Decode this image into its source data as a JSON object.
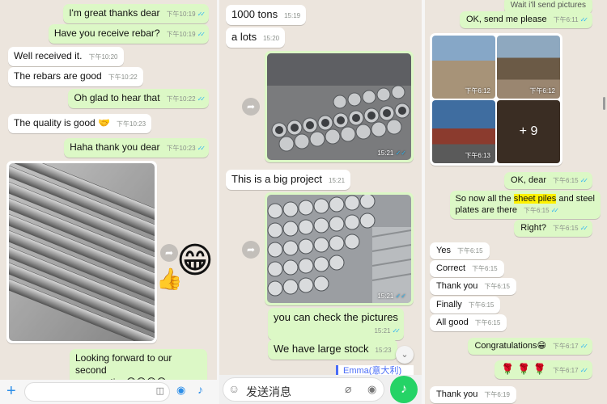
{
  "panel1": {
    "messages": [
      {
        "text": "I'm great thanks dear",
        "time": "下午10:19",
        "dir": "out",
        "read": true
      },
      {
        "text": "Have you receive rebar?",
        "time": "下午10:19",
        "dir": "out",
        "read": true
      },
      {
        "text": "Well received it.",
        "time": "下午10:20",
        "dir": "in"
      },
      {
        "text": "The rebars are good",
        "time": "下午10:22",
        "dir": "in"
      },
      {
        "text": "Oh glad to hear that",
        "time": "下午10:22",
        "dir": "out",
        "read": true
      },
      {
        "text": "The quality is good",
        "emoji": "🤝",
        "time": "下午10:23",
        "dir": "in"
      },
      {
        "text": "Haha thank you dear",
        "time": "下午10:23",
        "dir": "out",
        "read": true
      }
    ],
    "forward_line1": "Looking forward to our second",
    "forward_line2": "cooperation",
    "forward_emojis": "😁😁😁😁",
    "sticker_face": "😁",
    "sticker_thumbs": "👍"
  },
  "panel2": {
    "messages": [
      {
        "text": "1000 tons",
        "time": "15:19"
      },
      {
        "text": "a lots",
        "time": "15:20"
      }
    ],
    "image1_time": "15:21",
    "big_project": {
      "text": "This is a big project",
      "time": "15:21"
    },
    "image2_time": "15:21",
    "check_pictures": {
      "text": "you can check the pictures",
      "time": "15:21"
    },
    "large_stock": {
      "text": "We have large stock",
      "time": "15:23"
    },
    "sender_name": "Emma(意大利)",
    "input_placeholder": "发送消息",
    "scroll_down_icon": "chevron-down"
  },
  "panel3": {
    "top_quote": "Wait i'll send pictures",
    "ok_send": {
      "text": "OK, send me please",
      "time": "下午6:11"
    },
    "grid_times": [
      "下午6:12",
      "下午6:12",
      "下午6:13"
    ],
    "grid_more": "+ 9",
    "ok_dear": {
      "text": "OK, dear",
      "time": "下午6:15"
    },
    "so_now": {
      "pre": "So now all the ",
      "highlight": "sheet piles",
      "post": " and steel",
      "line2": "plates are there",
      "time": "下午6:15"
    },
    "right": {
      "text": "Right?",
      "time": "下午6:15"
    },
    "replies": [
      {
        "text": "Yes",
        "time": "下午6:15"
      },
      {
        "text": "Correct",
        "time": "下午6:15"
      },
      {
        "text": "Thank you",
        "time": "下午6:15"
      },
      {
        "text": "Finally",
        "time": "下午6:15"
      },
      {
        "text": "All good",
        "time": "下午6:15"
      }
    ],
    "congrats": {
      "text": "Congratulations",
      "emoji": "😁",
      "time": "下午6:17"
    },
    "roses": {
      "text": "🌹 🌹 🌹",
      "time": "下午6:17"
    },
    "thank_you2": {
      "text": "Thank you",
      "time": "下午6:19"
    }
  },
  "colors": {
    "outgoing": "#dcf8c6",
    "incoming": "#ffffff",
    "background": "#ece5dd",
    "read_ticks": "#34b7f1",
    "mic": "#25d366",
    "highlight": "#fff200"
  }
}
